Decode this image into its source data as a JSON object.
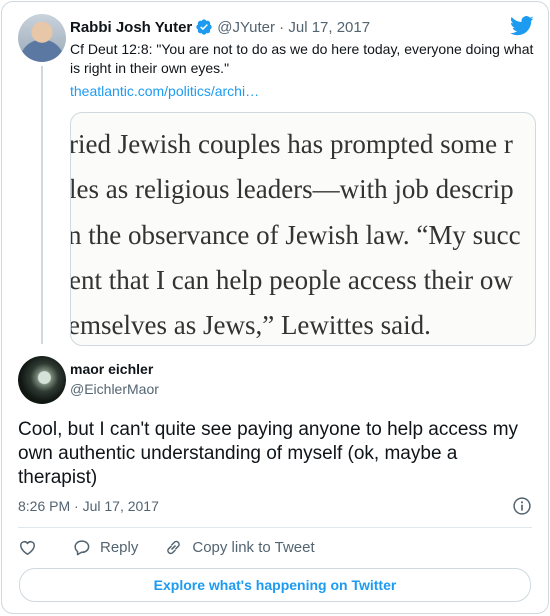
{
  "parent_tweet": {
    "author_name": "Rabbi Josh Yuter",
    "handle_date": "@JYuter · Jul 17, 2017",
    "text": "Cf Deut 12:8: \"You are not to do as we do here today, everyone doing what is right in their own eyes.\"",
    "link": "theatlantic.com/politics/archi…",
    "quote_lines": [
      "ried Jewish couples has prompted some r",
      "les as religious leaders—with job descrip",
      "n the observance of Jewish law. “My succ",
      "ent that I can help people access their ow",
      "emselves as Jews,” Lewittes said."
    ]
  },
  "reply_tweet": {
    "author_name": "maor eichler",
    "handle": "@EichlerMaor",
    "text": "Cool, but I can't quite see paying anyone to help access my own authentic understanding of myself (ok, maybe a therapist)",
    "timestamp": "8:26 PM · Jul 17, 2017"
  },
  "actions": {
    "reply_label": "Reply",
    "copy_label": "Copy link to Tweet"
  },
  "explore_label": "Explore what's happening on Twitter",
  "icons": [
    "twitter-bird-icon",
    "verified-badge-icon",
    "info-icon",
    "heart-icon",
    "reply-icon",
    "link-icon"
  ],
  "colors": {
    "accent": "#1d9bf0",
    "secondary_text": "#536471",
    "border": "#cfd9de"
  }
}
